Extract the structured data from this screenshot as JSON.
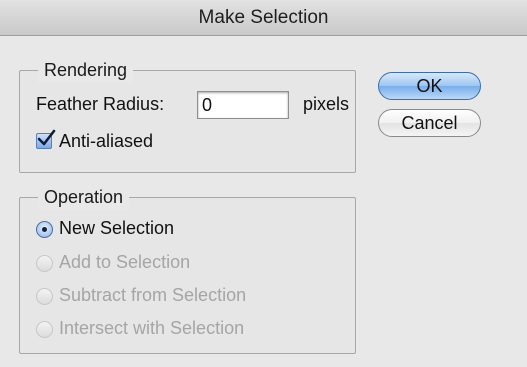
{
  "window": {
    "title": "Make Selection"
  },
  "rendering": {
    "group_label": "Rendering",
    "feather_radius_label": "Feather Radius:",
    "feather_radius_value": "0",
    "feather_radius_unit": "pixels",
    "anti_aliased_label": "Anti-aliased",
    "anti_aliased_checked": true
  },
  "operation": {
    "group_label": "Operation",
    "options": [
      {
        "label": "New Selection",
        "selected": true,
        "enabled": true
      },
      {
        "label": "Add to Selection",
        "selected": false,
        "enabled": false
      },
      {
        "label": "Subtract from Selection",
        "selected": false,
        "enabled": false
      },
      {
        "label": "Intersect with Selection",
        "selected": false,
        "enabled": false
      }
    ]
  },
  "buttons": {
    "ok_label": "OK",
    "cancel_label": "Cancel"
  },
  "colors": {
    "accent": "#7aaeea",
    "dialog_background": "#e8e8e8",
    "disabled_text": "#a5a5a5"
  }
}
